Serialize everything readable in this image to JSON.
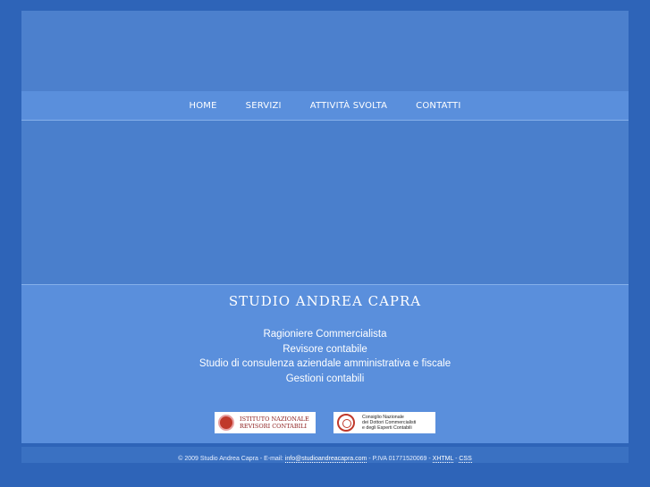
{
  "nav": {
    "items": [
      {
        "label": "HOME"
      },
      {
        "label": "SERVIZI"
      },
      {
        "label": "ATTIVITÀ SVOLTA"
      },
      {
        "label": "CONTATTI"
      }
    ]
  },
  "info": {
    "title": "STUDIO ANDREA CAPRA",
    "services": [
      "Ragioniere Commercialista",
      "Revisore contabile",
      "Studio di consulenza aziendale amministrativa e fiscale",
      "Gestioni contabili"
    ]
  },
  "logos": {
    "inrc_line1": "ISTITUTO NAZIONALE",
    "inrc_line2": "REVISORI CONTABILI",
    "cndc_line1": "Consiglio Nazionale",
    "cndc_line2": "dei Dottori Commercialisti",
    "cndc_line3": "e degli Esperti Contabili"
  },
  "footer": {
    "copyright": "© 2009 Studio Andrea Capra - E-mail: ",
    "email": "info@studioandreacapra.com",
    "piva": " - P.IVA 01771520069 - ",
    "xhtml": "XHTML",
    "sep": " - ",
    "css": "CSS"
  },
  "colors": {
    "background": "#2e64b8",
    "panel": "#4a7fcc",
    "band": "#5a8fdc"
  }
}
